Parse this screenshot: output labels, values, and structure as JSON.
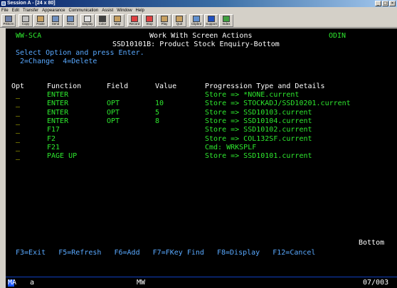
{
  "window": {
    "title": "Session A - [24 x 80]",
    "menu": [
      "File",
      "Edit",
      "Transfer",
      "Appearance",
      "Communication",
      "Assist",
      "Window",
      "Help"
    ],
    "toolbar": [
      {
        "label": "PrtScrn",
        "icon": "print-screen-icon",
        "color": "#6c7fa8"
      },
      {
        "label": "Copy",
        "icon": "copy-icon",
        "color": "#c0c0c0"
      },
      {
        "label": "Paste",
        "icon": "paste-icon",
        "color": "#c8a060"
      },
      {
        "label": "Send",
        "icon": "send-icon",
        "color": "#7090c0"
      },
      {
        "label": "Recv",
        "icon": "receive-icon",
        "color": "#7090c0"
      },
      {
        "label": "Display",
        "icon": "display-icon",
        "color": "#e0e0e0"
      },
      {
        "label": "Color",
        "icon": "color-icon",
        "color": "#404040"
      },
      {
        "label": "Map",
        "icon": "map-icon",
        "color": "#c8a060"
      },
      {
        "label": "Record",
        "icon": "record-icon",
        "color": "#e04040"
      },
      {
        "label": "Stop",
        "icon": "stop-icon",
        "color": "#e04040"
      },
      {
        "label": "Play",
        "icon": "play-icon",
        "color": "#c8a060"
      },
      {
        "label": "Quit",
        "icon": "quit-icon",
        "color": "#c8a060"
      },
      {
        "label": "Clipbrd",
        "icon": "clipboard-icon",
        "color": "#6090d0"
      },
      {
        "label": "Support",
        "icon": "support-icon",
        "color": "#2050c0"
      },
      {
        "label": "Index",
        "icon": "index-icon",
        "color": "#40a040"
      }
    ]
  },
  "screen": {
    "system": "WW-SCA",
    "heading": "Work With Screen Actions",
    "subheading": "SSD10101B: Product Stock Enquiry-Bottom",
    "host": "ODIN",
    "instruction": "Select Option and press Enter.",
    "options": "2=Change  4=Delete",
    "columns": {
      "opt": "Opt",
      "function": "Function",
      "field": "Field",
      "value": "Value",
      "progression": "Progression Type and Details"
    },
    "rows": [
      {
        "opt": "_",
        "function": "ENTER",
        "field": "",
        "value": "",
        "details": "Store => *NONE.current"
      },
      {
        "opt": "_",
        "function": "ENTER",
        "field": "OPT",
        "value": "10",
        "details": "Store => STOCKADJ/SSD10201.current"
      },
      {
        "opt": "_",
        "function": "ENTER",
        "field": "OPT",
        "value": "5",
        "details": "Store => SSD10103.current"
      },
      {
        "opt": "_",
        "function": "ENTER",
        "field": "OPT",
        "value": "8",
        "details": "Store => SSD10104.current"
      },
      {
        "opt": "_",
        "function": "F17",
        "field": "",
        "value": "",
        "details": "Store => SSD10102.current"
      },
      {
        "opt": "_",
        "function": "F2",
        "field": "",
        "value": "",
        "details": "Store => COL132SF.current"
      },
      {
        "opt": "_",
        "function": "F21",
        "field": "",
        "value": "",
        "details": "Cmd: WRKSPLF"
      },
      {
        "opt": "_",
        "function": "PAGE UP",
        "field": "",
        "value": "",
        "details": "Store => SSD10101.current"
      }
    ],
    "more_indicator": "Bottom",
    "function_keys": "F3=Exit   F5=Refresh   F6=Add   F7=FKey Find   F8=Display   F12=Cancel"
  },
  "status": {
    "indicator": "MA",
    "session": "a",
    "mode": "MW",
    "cursor": "07/003"
  },
  "colors": {
    "terminal_bg": "#000000",
    "field_green": "#2ee82e",
    "text_white": "#ffffff",
    "text_blue": "#59a9ff",
    "status_block": "#1856ff"
  }
}
